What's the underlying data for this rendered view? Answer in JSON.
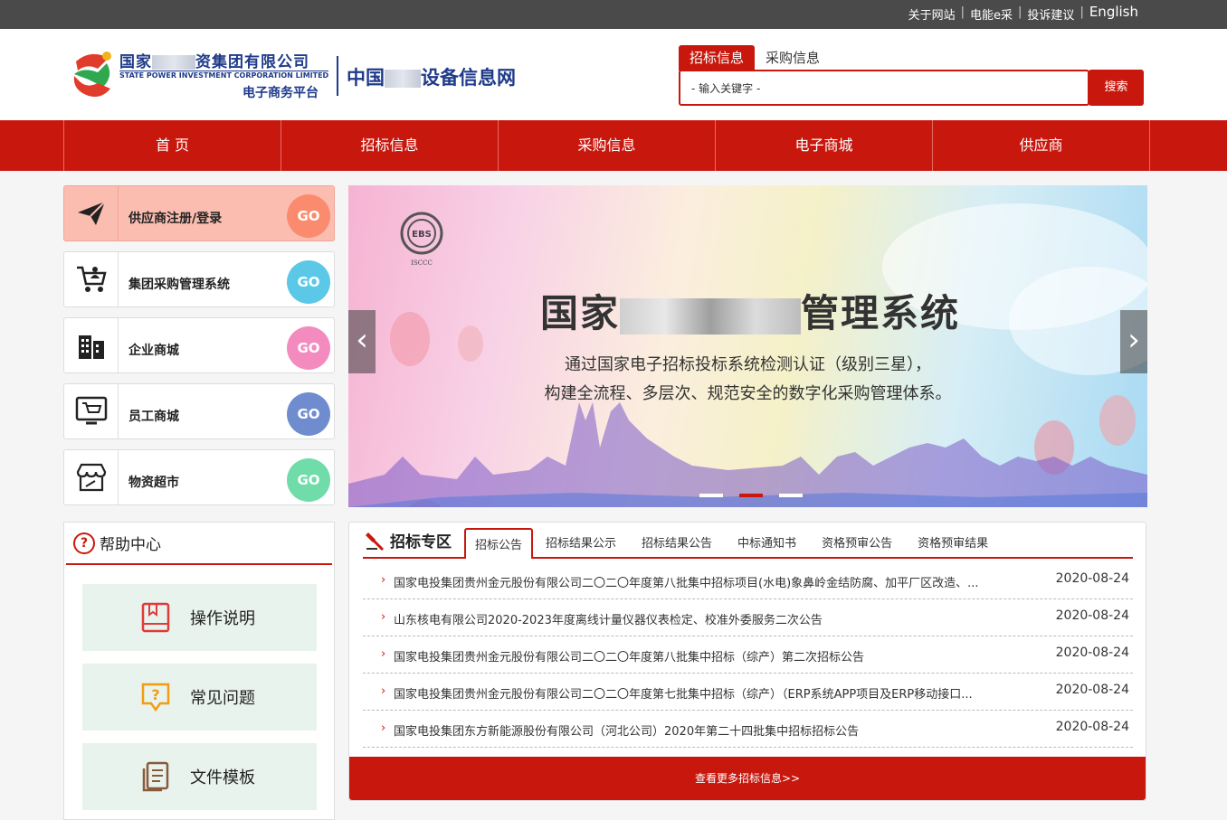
{
  "topbar": {
    "links": [
      "关于网站",
      "电能e采",
      "投诉建议",
      "English"
    ]
  },
  "header": {
    "logo_cn_prefix": "国家",
    "logo_cn_suffix": "资集团有限公司",
    "logo_en": "STATE POWER INVESTMENT CORPORATION LIMITED",
    "logo_platform": "电子商务平台",
    "site_prefix": "中国",
    "site_suffix": "设备信息网"
  },
  "search": {
    "tabs": [
      "招标信息",
      "采购信息"
    ],
    "active_tab": "招标信息",
    "placeholder": "- 输入关键字 -",
    "button": "搜索"
  },
  "nav": {
    "items": [
      "首 页",
      "招标信息",
      "采购信息",
      "电子商城",
      "供应商"
    ]
  },
  "sidebar": {
    "go_label": "GO",
    "items": [
      {
        "label": "供应商注册/登录",
        "icon": "paper-plane-icon",
        "color": "#fb8b6f"
      },
      {
        "label": "集团采购管理系统",
        "icon": "cart-person-icon",
        "color": "#5bc8e8"
      },
      {
        "label": "企业商城",
        "icon": "building-icon",
        "color": "#f38bbf"
      },
      {
        "label": "员工商城",
        "icon": "monitor-cart-icon",
        "color": "#6f8ccf"
      },
      {
        "label": "物资超市",
        "icon": "store-icon",
        "color": "#6fdca9"
      }
    ]
  },
  "help": {
    "title": "帮助中心",
    "items": [
      {
        "label": "操作说明",
        "icon": "book-icon",
        "color": "#e03b3b"
      },
      {
        "label": "常见问题",
        "icon": "question-bubble-icon",
        "color": "#f39c12"
      },
      {
        "label": "文件模板",
        "icon": "document-icon",
        "color": "#8a5a3a"
      }
    ]
  },
  "banner": {
    "title_prefix": "国家",
    "title_suffix": "管理系统",
    "line1": "通过国家电子招标投标系统检测认证（级别三星），",
    "line2": "构建全流程、多层次、规范安全的数字化采购管理体系。",
    "badge": "EBS",
    "badge_sub": "ISCCC",
    "prev": "‹",
    "next": "›"
  },
  "tender": {
    "title": "招标专区",
    "tabs": [
      "招标公告",
      "招标结果公示",
      "招标结果公告",
      "中标通知书",
      "资格预审公告",
      "资格预审结果"
    ],
    "active_tab": "招标公告",
    "rows": [
      {
        "text": "国家电投集团贵州金元股份有限公司二〇二〇年度第八批集中招标项目(水电)象鼻岭金结防腐、加平厂区改造、...",
        "date": "2020-08-24"
      },
      {
        "text": "山东核电有限公司2020-2023年度离线计量仪器仪表检定、校准外委服务二次公告",
        "date": "2020-08-24"
      },
      {
        "text": "国家电投集团贵州金元股份有限公司二〇二〇年度第八批集中招标（综产）第二次招标公告",
        "date": "2020-08-24"
      },
      {
        "text": "国家电投集团贵州金元股份有限公司二〇二〇年度第七批集中招标（综产）（ERP系统APP项目及ERP移动接口...",
        "date": "2020-08-24"
      },
      {
        "text": "国家电投集团东方新能源股份有限公司（河北公司）2020年第二十四批集中招标招标公告",
        "date": "2020-08-24"
      }
    ],
    "more": "查看更多招标信息>>"
  }
}
